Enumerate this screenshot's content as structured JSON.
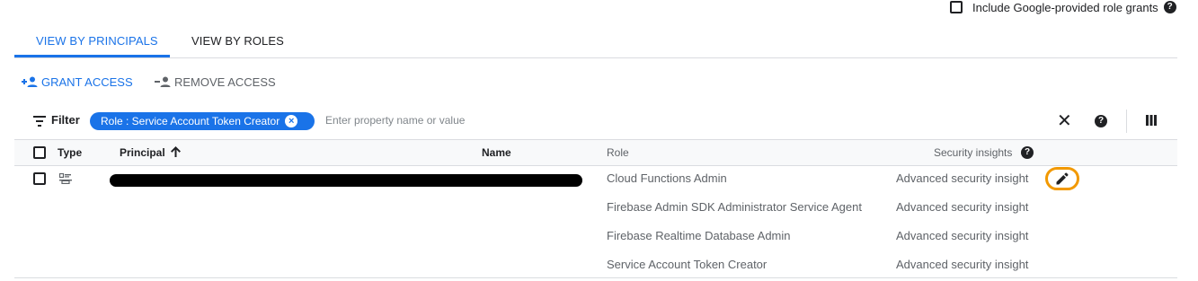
{
  "options": {
    "include_google_roles_label": "Include Google-provided role grants",
    "include_google_roles_checked": false
  },
  "tabs": [
    {
      "label": "VIEW BY PRINCIPALS",
      "active": true
    },
    {
      "label": "VIEW BY ROLES",
      "active": false
    }
  ],
  "actions": {
    "grant_label": "GRANT ACCESS",
    "remove_label": "REMOVE ACCESS"
  },
  "filter": {
    "label": "Filter",
    "chip_label": "Role : Service Account Token Creator",
    "placeholder": "Enter property name or value"
  },
  "table": {
    "columns": {
      "type": "Type",
      "principal": "Principal",
      "name": "Name",
      "role": "Role",
      "security": "Security insights"
    },
    "rows": [
      {
        "type_icon": "service-account-icon",
        "principal": "",
        "name": "",
        "roles": [
          "Cloud Functions Admin",
          "Firebase Admin SDK Administrator Service Agent",
          "Firebase Realtime Database Admin",
          "Service Account Token Creator"
        ],
        "insights": [
          "Advanced security insight",
          "Advanced security insight",
          "Advanced security insight",
          "Advanced security insight"
        ]
      }
    ]
  },
  "colors": {
    "accent": "#1a73e8",
    "highlight": "#f29900",
    "text": "#202124",
    "muted": "#5f6368",
    "divider": "#dadce0"
  }
}
